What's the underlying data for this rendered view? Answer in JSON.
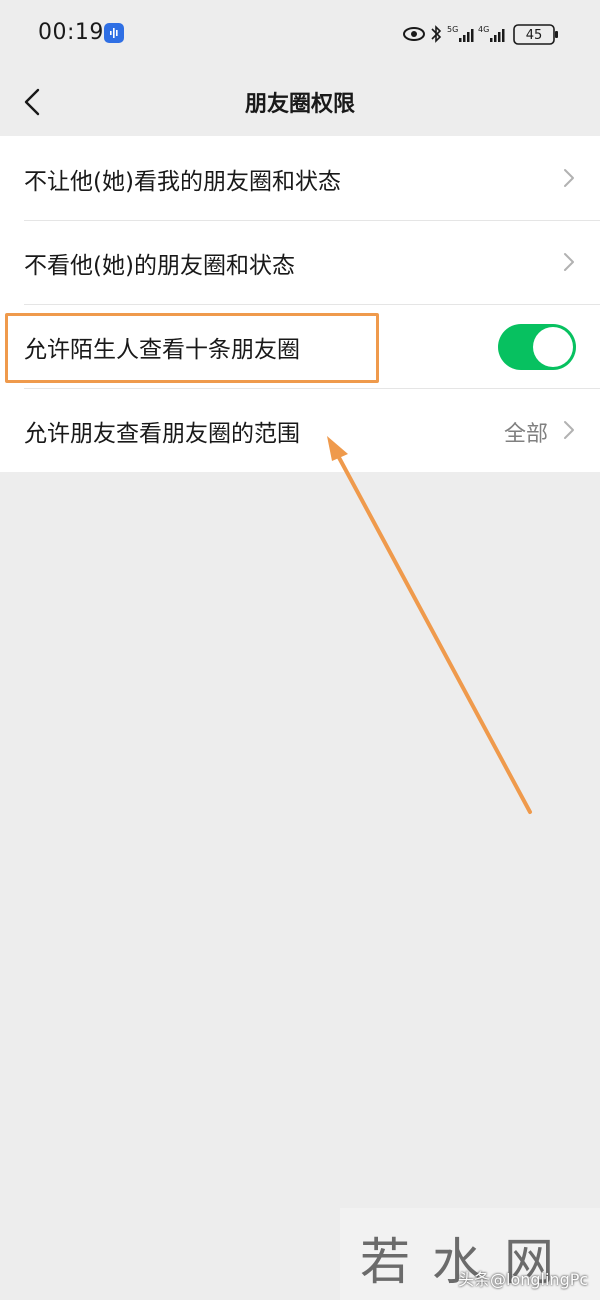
{
  "status_bar": {
    "time": "00:19",
    "network_labels": [
      "5G",
      "4G"
    ],
    "battery": "45",
    "icons": [
      "voice-app-icon",
      "eye-icon",
      "bluetooth-icon",
      "signal-icon",
      "battery-icon"
    ]
  },
  "nav": {
    "title": "朋友圈权限",
    "back_icon": "chevron-left-icon"
  },
  "rows": [
    {
      "label": "不让他(她)看我的朋友圈和状态",
      "accessory": "chevron"
    },
    {
      "label": "不看他(她)的朋友圈和状态",
      "accessory": "chevron"
    },
    {
      "label": "允许陌生人查看十条朋友圈",
      "accessory": "toggle",
      "toggle_on": true
    },
    {
      "label": "允许朋友查看朋友圈的范围",
      "value": "全部",
      "accessory": "chevron"
    }
  ],
  "annotation": {
    "highlight_color": "#ef9a4c",
    "arrow_color": "#ef9a4c"
  },
  "watermark": {
    "logo": "若水网",
    "credit": "头条@longlingPc"
  },
  "colors": {
    "background": "#ededed",
    "toggle_on": "#07c160",
    "text_primary": "#191919",
    "text_secondary": "#808080"
  }
}
